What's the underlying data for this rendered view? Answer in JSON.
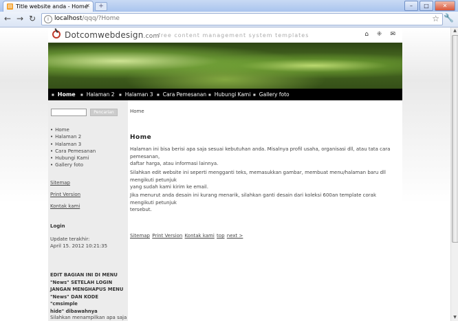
{
  "browser": {
    "tab_title": "Title website anda - Home",
    "tab_favicon": "cms-favicon",
    "new_tab": "+",
    "url_host": "localhost",
    "url_path": "/qqq/?Home",
    "window_min": "–",
    "window_max": "□",
    "window_close": "✕"
  },
  "site": {
    "logo_text": "Dotcomwebdesign",
    "logo_suffix": ".com",
    "tagline": "free content management system templates"
  },
  "nav": {
    "items": [
      "Home",
      "Halaman 2",
      "Halaman 3",
      "Cara Pemesanan",
      "Hubungi Kami",
      "Gallery foto"
    ]
  },
  "sidebar": {
    "search_button": "Pencarian",
    "menu": [
      "Home",
      "Halaman 2",
      "Halaman 3",
      "Cara Pemesanan",
      "Hubungi Kami",
      "Gallery foto"
    ],
    "sitemap": "Sitemap",
    "print_version": "Print Version",
    "contact": "Kontak kami",
    "login": "Login",
    "update_label": "Update terakhir:",
    "update_date": "April 15. 2012 10:21:35",
    "edit_line1": "EDIT BAGIAN INI DI MENU",
    "edit_line2": "\"News\" SETELAH LOGIN",
    "edit_line3": "JANGAN MENGHAPUS MENU",
    "edit_line4": "\"News\" DAN KODE \"cmsimple",
    "edit_line5": "hide\" dibawahnya",
    "bottom_text": "Silahkan menampilkan apa saja di"
  },
  "content": {
    "breadcrumb": "Home",
    "title": "Home",
    "p1_line1": "Halaman ini bisa berisi apa saja sesuai kebutuhan anda. Misalnya profil usaha, organisasi dll, atau tata cara pemesanan,",
    "p1_line2": "daftar harga, atau informasi lainnya.",
    "p2_line1": "Silahkan edit website ini seperti mengganti teks, memasukkan gambar, membuat menu/halaman baru dll mengikuti petunjuk",
    "p2_line2": "yang sudah kami kirim ke email.",
    "p3_line1": "Jika menurut anda desain ini kurang menarik, silahkan ganti desain dari koleksi 600an template corak mengikuti petunjuk",
    "p3_line2": "tersebut.",
    "footer_links": [
      "Sitemap",
      "Print Version",
      "Kontak kami",
      "top",
      "next >"
    ]
  }
}
